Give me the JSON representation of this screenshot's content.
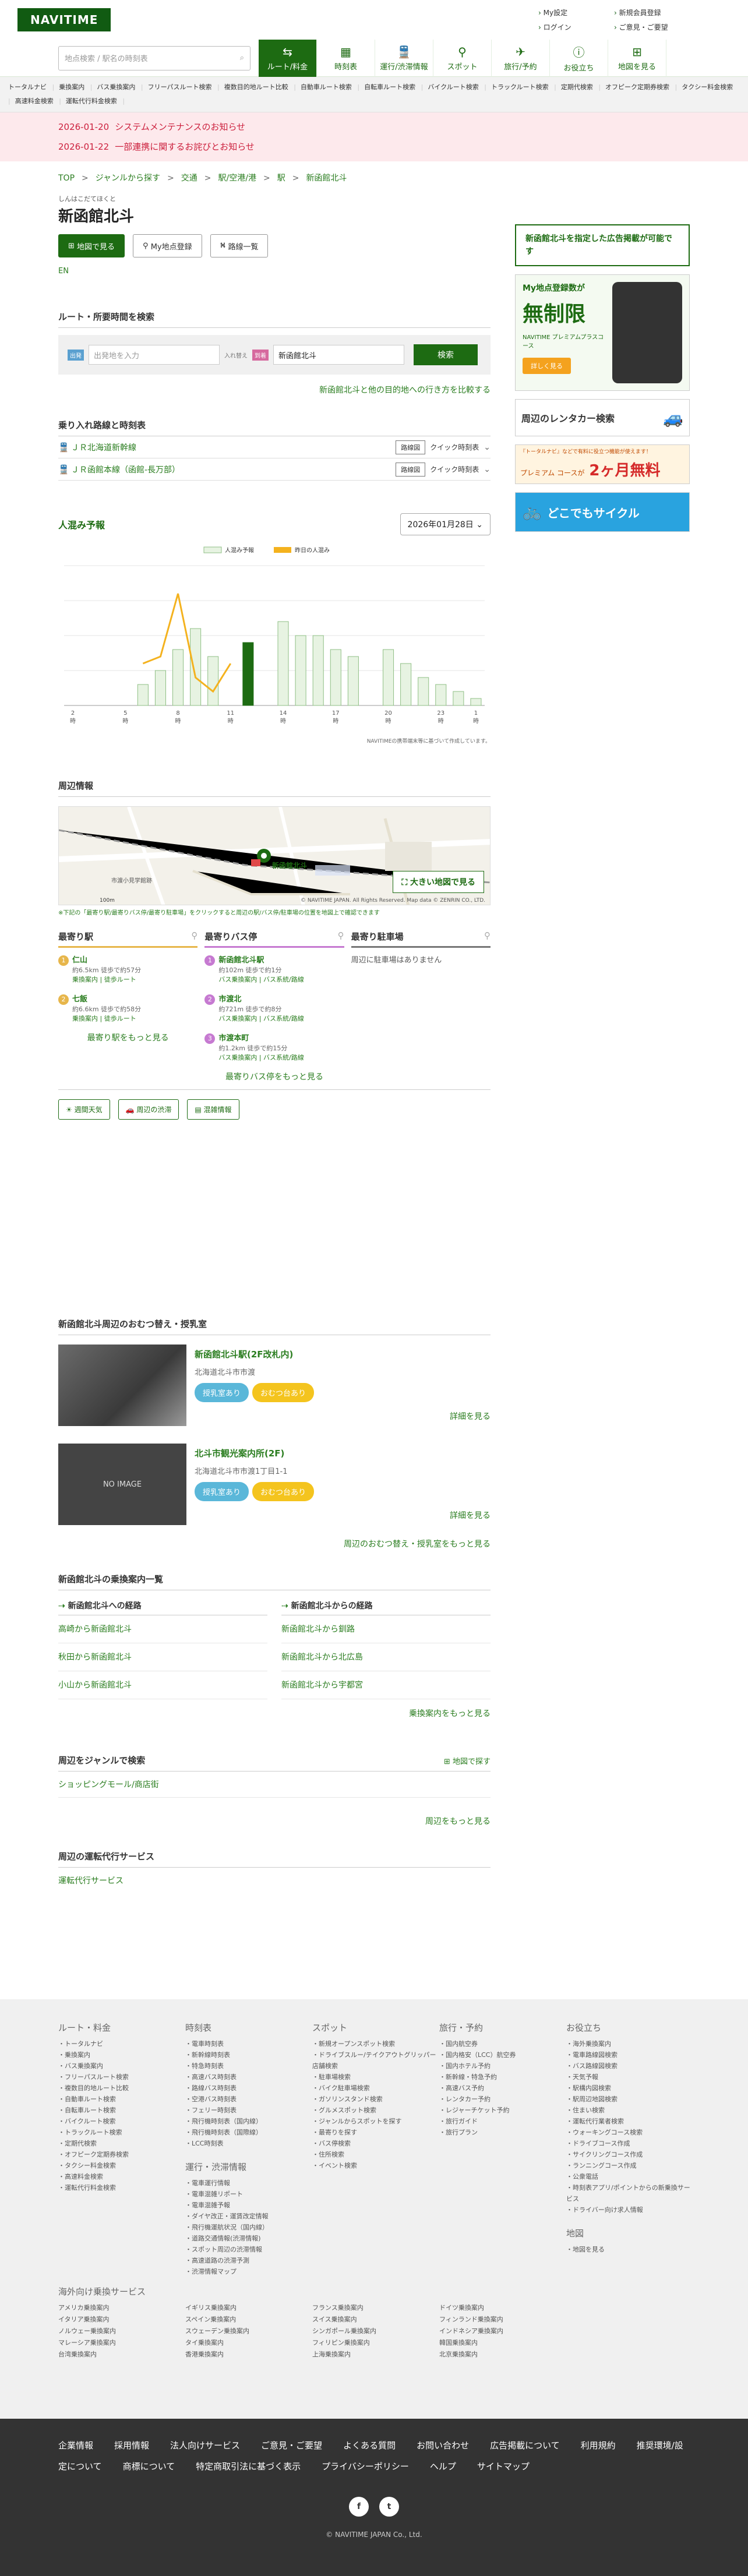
{
  "header": {
    "logo": "NAVITIME",
    "links": [
      "My設定",
      "新規会員登録",
      "ログイン",
      "ご意見・ご要望"
    ]
  },
  "search": {
    "placeholder": "地点検索 / 駅名の時刻表"
  },
  "nav": [
    {
      "icon": "route-icon",
      "label": "ルート/料金"
    },
    {
      "icon": "timetable-icon",
      "label": "時刻表"
    },
    {
      "icon": "train-icon",
      "label": "運行/渋滞情報"
    },
    {
      "icon": "pin-icon",
      "label": "スポット"
    },
    {
      "icon": "travel-icon",
      "label": "旅行/予約"
    },
    {
      "icon": "info-icon",
      "label": "お役立ち"
    },
    {
      "icon": "map-icon",
      "label": "地図を見る"
    }
  ],
  "subnav": [
    "トータルナビ",
    "乗換案内",
    "バス乗換案内",
    "フリーパスルート検索",
    "複数目的地ルート比較",
    "自動車ルート検索",
    "自転車ルート検索",
    "バイクルート検索",
    "トラックルート検索",
    "定期代検索",
    "オフピーク定期券検索",
    "タクシー料金検索",
    "高速料金検索",
    "運転代行料金検索"
  ],
  "notices": [
    {
      "date": "2026-01-20",
      "text": "システムメンテナンスのお知らせ"
    },
    {
      "date": "2026-01-22",
      "text": "一部連携に関するお詫びとお知らせ"
    }
  ],
  "breadcrumb": [
    "TOP",
    "ジャンルから探す",
    "交通",
    "駅/空港/港",
    "駅",
    "新函館北斗"
  ],
  "station": {
    "ruby": "しんはこだてほくと",
    "name": "新函館北斗",
    "btn_map": "地図で見る",
    "btn_my": "My地点登録",
    "btn_lines": "路線一覧",
    "kana": "EN"
  },
  "route": {
    "title": "ルート・所要時間を検索",
    "from_tag": "出発",
    "from_placeholder": "出発地を入力",
    "swap": "入れ替え",
    "to_tag": "到着",
    "to_value": "新函館北斗",
    "search": "検索",
    "link": "新函館北斗と他の目的地への行き方を比較する"
  },
  "lines": {
    "title": "乗り入れ路線と時刻表",
    "items": [
      {
        "name": "ＪＲ北海道新幹線",
        "btn1": "路線図",
        "btn2": "クイック時刻表"
      },
      {
        "name": "ＪＲ函館本線（函館-長万部）",
        "btn1": "路線図",
        "btn2": "クイック時刻表"
      }
    ]
  },
  "crowd": {
    "title": "人混み予報",
    "date": "2026年01月28日",
    "legend_bar": "人混み予報",
    "legend_line": "昨日の人混み",
    "note": "NAVITIMEの携帯端末等に基づいて作成しています。"
  },
  "chart_data": {
    "type": "bar",
    "categories": [
      "2",
      "3",
      "4",
      "5",
      "6",
      "7",
      "8",
      "9",
      "10",
      "11",
      "12",
      "13",
      "14",
      "15",
      "16",
      "17",
      "18",
      "19",
      "20",
      "21",
      "22",
      "23",
      "24",
      "1"
    ],
    "series": [
      {
        "name": "人混み予報",
        "values": [
          0,
          0,
          0,
          0,
          15,
          25,
          40,
          55,
          35,
          0,
          45,
          0,
          60,
          50,
          50,
          40,
          35,
          0,
          40,
          30,
          20,
          15,
          10,
          5
        ]
      },
      {
        "name": "昨日の人混み",
        "values": [
          0,
          0,
          0,
          0,
          30,
          35,
          80,
          20,
          10,
          30,
          0,
          0,
          0,
          0,
          0,
          0,
          0,
          0,
          0,
          0,
          0,
          0,
          0,
          0
        ]
      }
    ],
    "highlight_index": 10,
    "ylim": [
      0,
      100
    ],
    "colors": {
      "bar": "#e7f3e2",
      "bar_border": "#8fbf85",
      "highlight": "#1d6b12",
      "line": "#f4b21e"
    },
    "xlabel_suffix": "時"
  },
  "surround": {
    "title": "周辺情報",
    "bigmap": "大きい地図で見る",
    "station_label": "新函館北斗",
    "place_label": "市渡小見学館跡",
    "copyright": "© NAVITIME JAPAN. All Rights Reserved. Map data © ZENRIN CO., LTD.",
    "scale": "100m",
    "note": "※下記の「最寄り駅/最寄りバス停/最寄り駐車場」をクリックすると周辺の駅/バス停/駐車場の位置を地図上で確認できます"
  },
  "nearest_station": {
    "title": "最寄り駅",
    "items": [
      {
        "num": "1",
        "name": "仁山",
        "dist": "約6.5km 徒歩で約57分",
        "links": "乗換案内 | 徒歩ルート"
      },
      {
        "num": "2",
        "name": "七飯",
        "dist": "約6.6km 徒歩で約58分",
        "links": "乗換案内 | 徒歩ルート"
      }
    ],
    "more": "最寄り駅をもっと見る"
  },
  "nearest_bus": {
    "title": "最寄りバス停",
    "items": [
      {
        "num": "1",
        "name": "新函館北斗駅",
        "dist": "約102m 徒歩で約1分",
        "links": "バス乗換案内 | バス系統/路線"
      },
      {
        "num": "2",
        "name": "市渡北",
        "dist": "約721m 徒歩で約8分",
        "links": "バス乗換案内 | バス系統/路線"
      },
      {
        "num": "3",
        "name": "市渡本町",
        "dist": "約1.2km 徒歩で約15分",
        "links": "バス乗換案内 | バス系統/路線"
      }
    ],
    "more": "最寄りバス停をもっと見る"
  },
  "nearest_parking": {
    "title": "最寄り駐車場",
    "empty": "周辺に駐車場はありません"
  },
  "weather": [
    "週間天気",
    "周辺の渋滞",
    "混雑情報"
  ],
  "nursing": {
    "title": "新函館北斗周辺のおむつ替え・授乳室",
    "items": [
      {
        "name": "新函館北斗駅(2F改札内)",
        "addr": "北海道北斗市市渡",
        "pill1": "授乳室あり",
        "pill2": "おむつ台あり",
        "detail": "詳細を見る",
        "img": ""
      },
      {
        "name": "北斗市観光案内所(2F)",
        "addr": "北海道北斗市市渡1丁目1-1",
        "pill1": "授乳室あり",
        "pill2": "おむつ台あり",
        "detail": "詳細を見る",
        "img": "NO IMAGE"
      }
    ],
    "more": "周辺のおむつ替え・授乳室をもっと見る"
  },
  "transfer": {
    "title": "新函館北斗の乗換案内一覧",
    "to_head": "新函館北斗への経路",
    "from_head": "新函館北斗からの経路",
    "to": [
      "高崎から新函館北斗",
      "秋田から新函館北斗",
      "小山から新函館北斗"
    ],
    "from": [
      "新函館北斗から釧路",
      "新函館北斗から北広島",
      "新函館北斗から宇都宮"
    ],
    "more": "乗換案内をもっと見る"
  },
  "genre": {
    "title": "周辺をジャンルで検索",
    "map": "地図で探す",
    "items": [
      "ショッピングモール/商店街"
    ],
    "more": "周辺をもっと見る"
  },
  "daiko": {
    "title": "周辺の運転代行サービス",
    "items": [
      "運転代行サービス"
    ]
  },
  "side": {
    "ad_text": "新函館北斗を指定した広告掲載が可能です",
    "ad1_title": "My地点登録数が",
    "ad1_big": "無制限",
    "ad1_sub": "NAVITIME プレミアムプラスコース",
    "ad1_cta": "詳しく見る",
    "ad2": "周辺のレンタカー検索",
    "ad3_top": "『トータルナビ』などで有料に役立つ機能が使えます！",
    "ad3_main": "プレミアム コースが",
    "ad3_big": "2ヶ月無料",
    "ad4": "どこでもサイクル"
  },
  "footer": {
    "cols": [
      {
        "h": "ルート・料金",
        "items": [
          "トータルナビ",
          "乗換案内",
          "バス乗換案内",
          "フリーパスルート検索",
          "複数目的地ルート比較",
          "自動車ルート検索",
          "自転車ルート検索",
          "バイクルート検索",
          "トラックルート検索",
          "定期代検索",
          "オフピーク定期券検索",
          "タクシー料金検索",
          "高速料金検索",
          "運転代行料金検索"
        ]
      },
      {
        "h": "時刻表",
        "items": [
          "電車時刻表",
          "新幹線時刻表",
          "特急時刻表",
          "高速バス時刻表",
          "路線バス時刻表",
          "空港バス時刻表",
          "フェリー時刻表",
          "飛行機時刻表（国内線）",
          "飛行機時刻表（国際線）",
          "LCC時刻表"
        ],
        "h2": "運行・渋滞情報",
        "items2": [
          "電車運行情報",
          "電車混雑リポート",
          "電車混雑予報",
          "ダイヤ改正・運賃改定情報",
          "飛行機運航状況（国内線）",
          "道路交通情報(渋滞情報)",
          "スポット周辺の渋滞情報",
          "高速道路の渋滞予測",
          "渋滞情報マップ"
        ]
      },
      {
        "h": "スポット",
        "items": [
          "新規オープンスポット検索",
          "ドライブスルー/テイクアウトグリッパー店舗検索",
          "駐車場検索",
          "バイク駐車場検索",
          "ガソリンスタンド検索",
          "グルメスポット検索",
          "ジャンルからスポットを探す",
          "最寄りを探す",
          "バス停検索",
          "住所検索",
          "イベント検索"
        ]
      },
      {
        "h": "旅行・予約",
        "items": [
          "国内航空券",
          "国内格安（LCC）航空券",
          "国内ホテル予約",
          "新幹線・特急予約",
          "高速バス予約",
          "レンタカー予約",
          "レジャーチケット予約",
          "旅行ガイド",
          "旅行プラン"
        ]
      },
      {
        "h": "お役立ち",
        "items": [
          "海外乗換案内",
          "電車路線図検索",
          "バス路線図検索",
          "天気予報",
          "駅構内図検索",
          "駅周辺地図検索",
          "住まい検索",
          "運転代行業者検索",
          "ウォーキングコース検索",
          "ドライブコース作成",
          "サイクリングコース作成",
          "ランニングコース作成",
          "公衆電話",
          "時刻表アプリ/ポイントからの新乗換サービス",
          "ドライバー向け求人情報"
        ],
        "h2": "地図",
        "items2": [
          "地図を見る"
        ]
      }
    ],
    "intl_title": "海外向け乗換サービス",
    "intl": [
      "アメリカ乗換案内",
      "イギリス乗換案内",
      "フランス乗換案内",
      "ドイツ乗換案内",
      "イタリア乗換案内",
      "スペイン乗換案内",
      "スイス乗換案内",
      "フィンランド乗換案内",
      "ノルウェー乗換案内",
      "スウェーデン乗換案内",
      "シンガポール乗換案内",
      "インドネシア乗換案内",
      "マレーシア乗換案内",
      "タイ乗換案内",
      "フィリピン乗換案内",
      "韓国乗換案内",
      "台湾乗換案内",
      "香港乗換案内",
      "上海乗換案内",
      "北京乗換案内"
    ]
  },
  "bottom": {
    "links": [
      "企業情報",
      "採用情報",
      "法人向けサービス",
      "ご意見・ご要望",
      "よくある質問",
      "お問い合わせ",
      "広告掲載について",
      "利用規約",
      "推奨環境/設定について",
      "商標について",
      "特定商取引法に基づく表示",
      "プライバシーポリシー",
      "ヘルプ",
      "サイトマップ"
    ],
    "social": [
      "f",
      "t"
    ],
    "copyright": "© NAVITIME JAPAN Co., Ltd."
  }
}
